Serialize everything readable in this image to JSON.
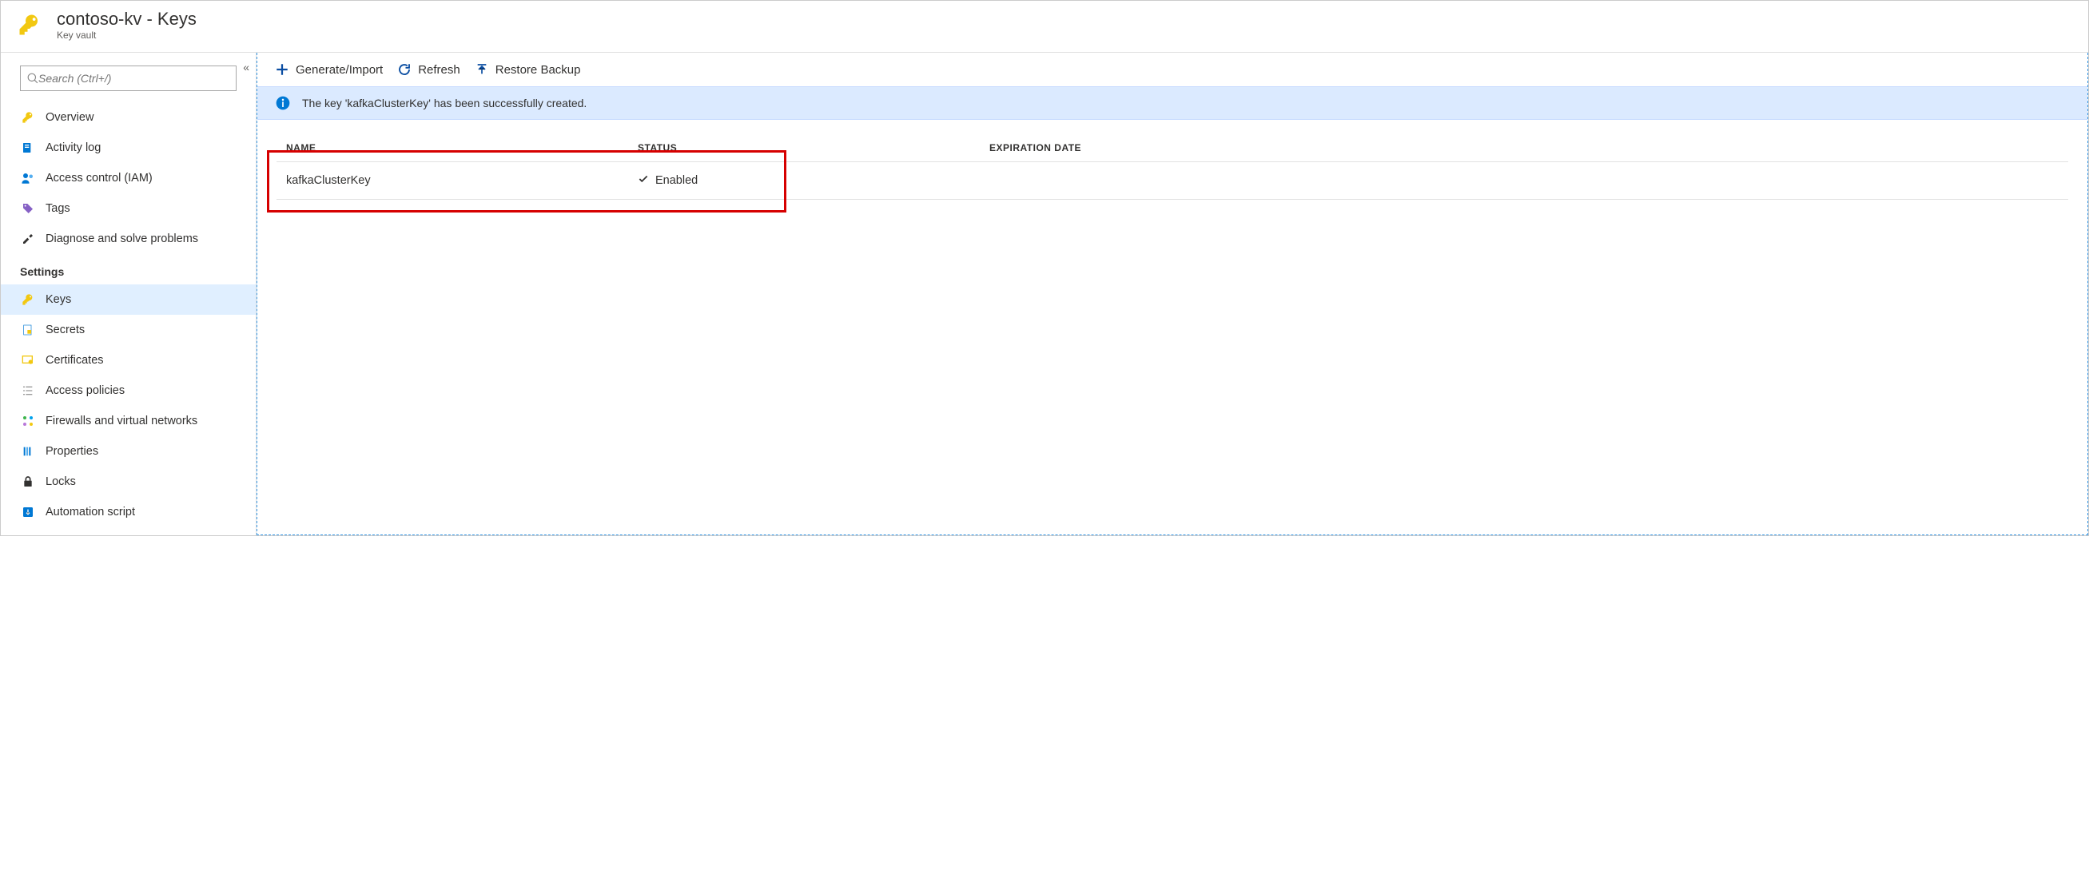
{
  "header": {
    "title": "contoso-kv - Keys",
    "subtitle": "Key vault"
  },
  "sidebar": {
    "search_placeholder": "Search (Ctrl+/)",
    "items_top": [
      {
        "label": "Overview"
      },
      {
        "label": "Activity log"
      },
      {
        "label": "Access control (IAM)"
      },
      {
        "label": "Tags"
      },
      {
        "label": "Diagnose and solve problems"
      }
    ],
    "group_settings_label": "Settings",
    "items_settings": [
      {
        "label": "Keys"
      },
      {
        "label": "Secrets"
      },
      {
        "label": "Certificates"
      },
      {
        "label": "Access policies"
      },
      {
        "label": "Firewalls and virtual networks"
      },
      {
        "label": "Properties"
      },
      {
        "label": "Locks"
      },
      {
        "label": "Automation script"
      }
    ]
  },
  "toolbar": {
    "generate_label": "Generate/Import",
    "refresh_label": "Refresh",
    "restore_label": "Restore Backup"
  },
  "notice": {
    "text": "The key 'kafkaClusterKey' has been successfully created."
  },
  "table": {
    "col_name": "NAME",
    "col_status": "STATUS",
    "col_exp": "EXPIRATION DATE",
    "rows": [
      {
        "name": "kafkaClusterKey",
        "status": "Enabled",
        "expiration": ""
      }
    ]
  }
}
